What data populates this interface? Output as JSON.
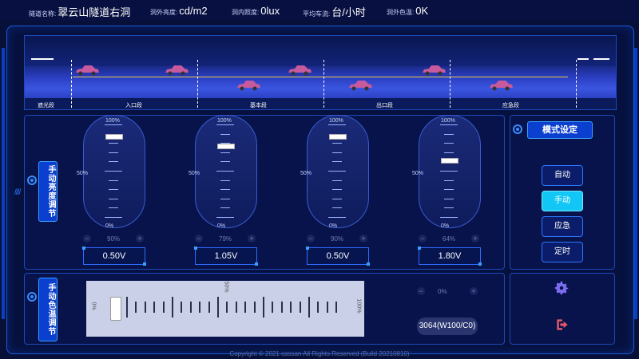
{
  "topbar": {
    "tunnel_name_label": "隧道名称:",
    "tunnel_name": "翠云山隧道右洞",
    "outside_brightness_label": "洞外亮度:",
    "outside_brightness": "cd/m2",
    "inside_illum_label": "洞内照度:",
    "inside_illum": "0lux",
    "traffic_label": "平均车流:",
    "traffic": "台/小时",
    "color_temp_label": "洞外色温:",
    "color_temp": "0K"
  },
  "tunnel": {
    "zones": [
      "遮光段",
      "入口段",
      "基本段",
      "出口段",
      "应急段"
    ]
  },
  "brightness": {
    "tab_label": "手动亮度调节",
    "pct_100": "100%",
    "pct_50": "50%",
    "pct_0": "0%",
    "channels": [
      {
        "level": "90%",
        "voltage": "0.50V",
        "value": 0.9
      },
      {
        "level": "79%",
        "voltage": "1.05V",
        "value": 0.79
      },
      {
        "level": "90%",
        "voltage": "0.50V",
        "value": 0.9
      },
      {
        "level": "64%",
        "voltage": "1.80V",
        "value": 0.64
      }
    ],
    "minus": "−",
    "plus": "+"
  },
  "mode": {
    "title": "模式设定",
    "buttons": [
      {
        "label": "自动",
        "active": false
      },
      {
        "label": "手动",
        "active": true
      },
      {
        "label": "应急",
        "active": false
      },
      {
        "label": "定时",
        "active": false
      }
    ]
  },
  "color_temp": {
    "tab_label": "手动色温调节",
    "label_0": "0%",
    "label_50": "50%",
    "label_100": "100%",
    "level": "0%",
    "readout": "3064(W100/C0)"
  },
  "footer": {
    "copyright": "Copyright © 2021 cassan All Rights Reserved (Build 20210810)"
  },
  "colors": {
    "accent": "#12c6f5",
    "panel_border": "#1d49b8",
    "car": "#c65a9c"
  },
  "icons": {
    "settings": "gear-icon",
    "exit": "logout-icon"
  }
}
